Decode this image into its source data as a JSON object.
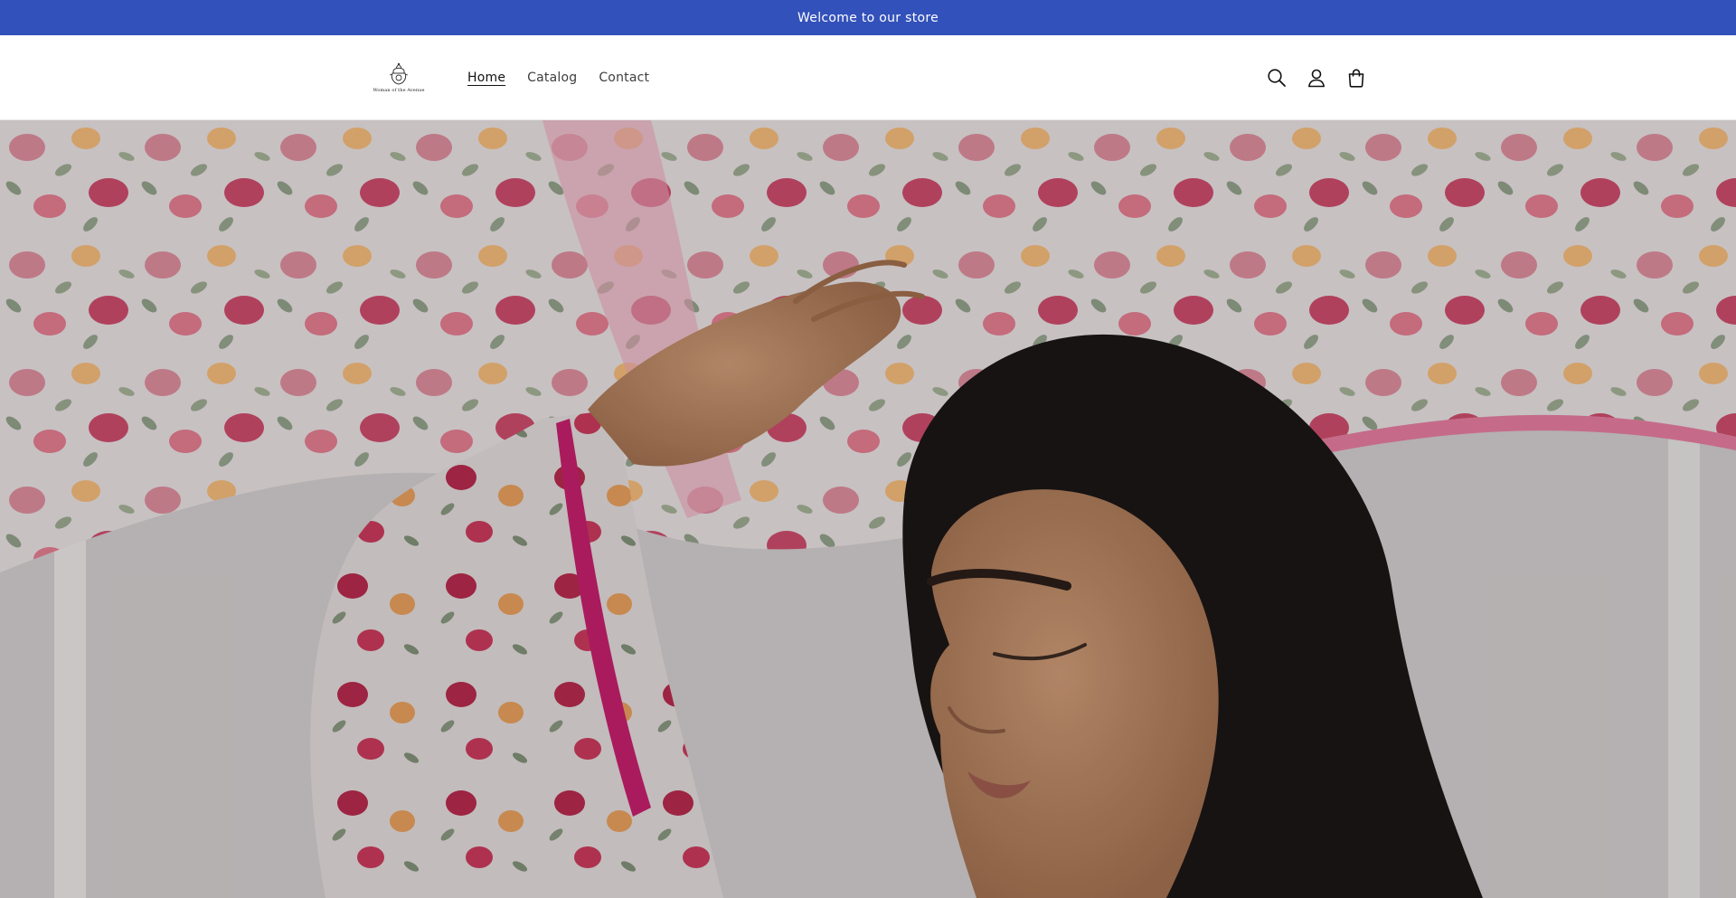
{
  "announcement": {
    "text": "Welcome to our store",
    "background": "#3351ba"
  },
  "header": {
    "logo": {
      "text": "Woman of the Avenue"
    },
    "nav": [
      {
        "label": "Home",
        "active": true
      },
      {
        "label": "Catalog",
        "active": false
      },
      {
        "label": "Contact",
        "active": false
      }
    ],
    "icons": [
      "search-icon",
      "account-icon",
      "cart-icon"
    ]
  },
  "hero": {
    "image": "woman-in-floral-dupatta-photo",
    "overlay": "dark-tint"
  }
}
